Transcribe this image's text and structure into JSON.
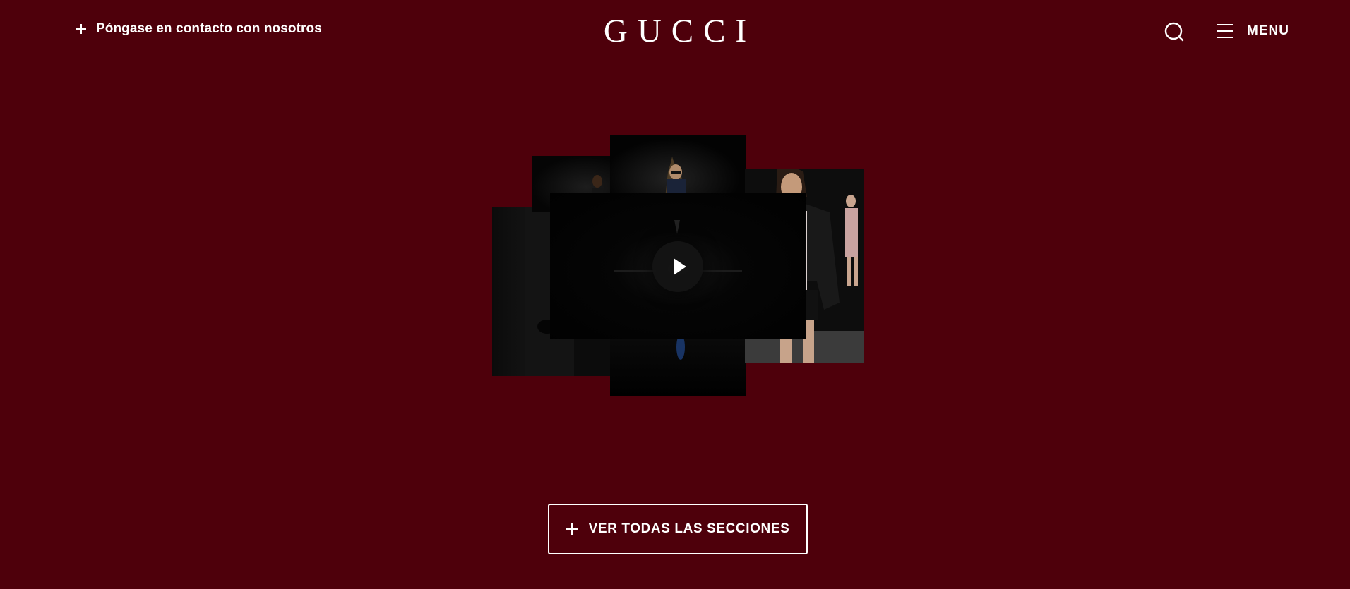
{
  "header": {
    "contact_label": "Póngase en contacto con nosotros",
    "logo_text": "GUCCI",
    "search_icon": "search-icon",
    "menu_icon": "hamburger-icon",
    "menu_label": "MENU"
  },
  "gallery": {
    "play_icon": "play-icon"
  },
  "cta": {
    "label": "VER TODAS LAS SECCIONES",
    "icon": "plus-icon"
  },
  "colors": {
    "background": "#4e000b",
    "text": "#ffffff"
  }
}
